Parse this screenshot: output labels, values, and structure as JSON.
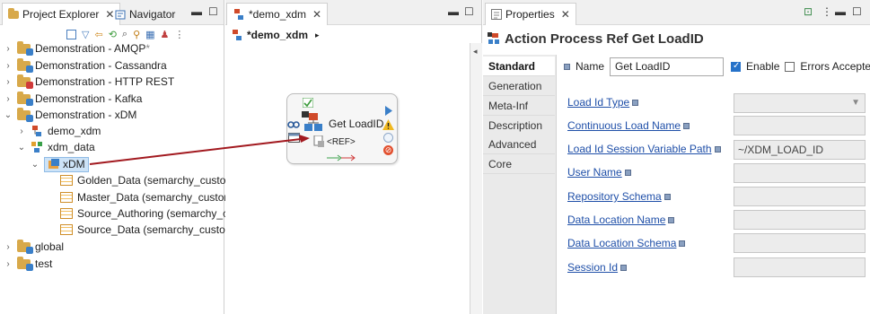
{
  "left_panel": {
    "tabs": [
      {
        "label": "Project Explorer",
        "close": "✕"
      },
      {
        "label": "Navigator"
      }
    ],
    "tree": [
      {
        "label": "Demonstration - AMQP",
        "suffix": "*",
        "expanded": false,
        "level": 0
      },
      {
        "label": "Demonstration - Cassandra",
        "expanded": false,
        "level": 0
      },
      {
        "label": "Demonstration - HTTP REST",
        "expanded": false,
        "level": 0
      },
      {
        "label": "Demonstration - Kafka",
        "expanded": false,
        "level": 0
      },
      {
        "label": "Demonstration - xDM",
        "expanded": true,
        "level": 0
      },
      {
        "label": "demo_xdm",
        "expanded": false,
        "level": 1
      },
      {
        "label": "xdm_data",
        "expanded": true,
        "level": 1
      },
      {
        "label": "xDM",
        "expanded": true,
        "level": 2,
        "selected": true
      },
      {
        "label": "Golden_Data (semarchy_custon",
        "level": 3
      },
      {
        "label": "Master_Data (semarchy_custom",
        "level": 3
      },
      {
        "label": "Source_Authoring (semarchy_cu",
        "level": 3
      },
      {
        "label": "Source_Data (semarchy_custom",
        "level": 3
      },
      {
        "label": "global",
        "expanded": false,
        "level": 0
      },
      {
        "label": "test",
        "expanded": false,
        "level": 0
      }
    ]
  },
  "editor": {
    "tab_label": "*demo_xdm",
    "tab_close": "✕",
    "breadcrumb": "*demo_xdm",
    "node": {
      "title": "Get LoadID",
      "subtitle": "<REF>"
    }
  },
  "properties": {
    "tab_label": "Properties",
    "tab_close": "✕",
    "header": "Action Process Ref Get LoadID",
    "side_tabs": [
      "Standard",
      "Generation",
      "Meta-Inf",
      "Description",
      "Advanced",
      "Core"
    ],
    "selected_tab": "Standard",
    "name_label": "Name",
    "name_value": "Get LoadID",
    "enable_label": "Enable",
    "enable_checked": true,
    "errors_label": "Errors Accepte",
    "errors_checked": false,
    "fields": [
      {
        "label": "Load Id Type",
        "value": "",
        "type": "select"
      },
      {
        "label": "Continuous Load Name",
        "value": ""
      },
      {
        "label": "Load Id Session Variable Path",
        "value": "~/XDM_LOAD_ID"
      },
      {
        "label": "User Name",
        "value": ""
      },
      {
        "label": "Repository Schema",
        "value": ""
      },
      {
        "label": "Data Location Name",
        "value": ""
      },
      {
        "label": "Data Location Schema",
        "value": ""
      },
      {
        "label": "Session Id",
        "value": ""
      }
    ]
  },
  "colors": {
    "accent": "#2672c9",
    "link": "#1f4fa8",
    "selection": "#cde3f7",
    "arrow": "#a2191f"
  }
}
